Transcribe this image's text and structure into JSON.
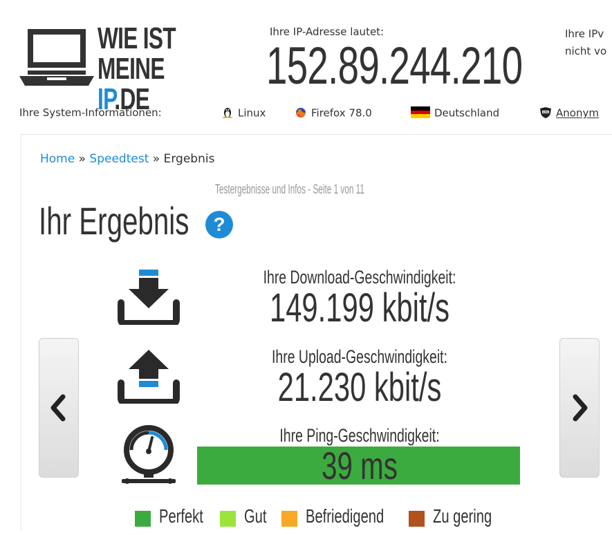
{
  "header": {
    "logo_line1": "WIE IST",
    "logo_line2_a": "MEINE ",
    "logo_line2_b": "IP",
    "logo_line2_c": ".DE",
    "ip_label": "Ihre IP-Adresse lautet:",
    "ip_value": "152.89.244.210",
    "ipv6_line1": "Ihre IPv",
    "ipv6_line2": "nicht vo"
  },
  "sysinfo": {
    "label": "Ihre System-Informationen:",
    "os": "Linux",
    "browser": "Firefox 78.0",
    "country": "Deutschland",
    "anon": "Anonym"
  },
  "breadcrumb": {
    "home": "Home",
    "sep1": " » ",
    "speedtest": "Speedtest",
    "sep2": " » ",
    "current": "Ergebnis"
  },
  "page": {
    "subtitle": "Testergebnisse und Infos - Seite 1 von 11",
    "title": "Ihr Ergebnis",
    "help_glyph": "?"
  },
  "results": {
    "download_label": "Ihre Download-Geschwindigkeit:",
    "download_value": "149.199 kbit/s",
    "upload_label": "Ihre Upload-Geschwindigkeit:",
    "upload_value": "21.230 kbit/s",
    "ping_label": "Ihre Ping-Geschwindigkeit:",
    "ping_value": "39 ms",
    "ping_rating_color": "#3cab3f"
  },
  "nav": {
    "prev_glyph": "‹",
    "next_glyph": "›"
  },
  "legend": [
    {
      "label": "Perfekt",
      "color": "#3cab3f"
    },
    {
      "label": "Gut",
      "color": "#9be53b"
    },
    {
      "label": "Befriedigend",
      "color": "#f7a824"
    },
    {
      "label": "Zu gering",
      "color": "#b0521d"
    }
  ],
  "icons": {
    "download": "download-icon",
    "upload": "upload-icon",
    "ping": "speedometer-icon",
    "linux": "linux-tux-icon",
    "firefox": "firefox-icon",
    "flag": "germany-flag-icon",
    "vpn": "vpn-shield-icon"
  },
  "colors": {
    "accent": "#1e8bd6",
    "text": "#333333"
  }
}
